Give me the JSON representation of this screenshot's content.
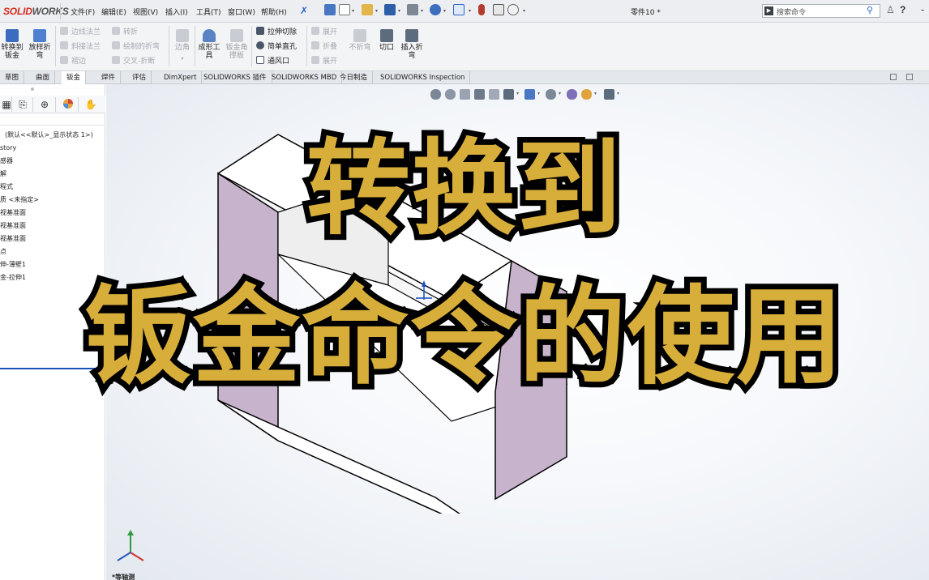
{
  "app": {
    "logo_brand": "SOLID",
    "logo_rest": "WORKS",
    "document_title": "零件10 *"
  },
  "menu": [
    "文件(F)",
    "编辑(E)",
    "视图(V)",
    "插入(I)",
    "工具(T)",
    "窗口(W)",
    "帮助(H)"
  ],
  "search": {
    "placeholder": "搜索命令"
  },
  "help_label": "?",
  "ribbon": {
    "convert_to_sheetmetal": "转换到\n钣金",
    "lofted_bend": "放样折\n弯",
    "edge_flange": "边线法兰",
    "miter_flange": "斜接法兰",
    "hem": "褶边",
    "jog": "转折",
    "sketched_bend": "绘制的折弯",
    "cross_break": "交叉-折断",
    "corners": "边角",
    "forming_tool": "成形工\n具",
    "sheetmetal_gusset": "钣金角\n撑板",
    "extruded_cut": "拉伸切除",
    "simple_hole": "简单直孔",
    "vent": "通风口",
    "unfold": "展开",
    "fold": "折叠",
    "flatten": "展开",
    "no_bends": "不折弯",
    "rip": "切口",
    "insert_bends": "插入折\n弯"
  },
  "tabs": [
    "草图",
    "曲面",
    "钣金",
    "焊件",
    "评估",
    "DimXpert",
    "SOLIDWORKS 插件",
    "SOLIDWORKS MBD",
    "今日制造",
    "SOLIDWORKS Inspection"
  ],
  "active_tab": "钣金",
  "feature_tree": {
    "config_line": "(默认<<默认>_显示状态 1>)",
    "items": [
      "story",
      "感器",
      "解",
      "程式",
      "质 <未指定>",
      "视基准面",
      "视基准面",
      "视基准面",
      "点",
      "伸-薄壁1",
      "金-拉伸1"
    ]
  },
  "view_label": "*等轴测",
  "overlay": {
    "line1": "转换到",
    "line2": "钣金命令的使用"
  },
  "colors": {
    "overlay_text": "#d8ae3a",
    "overlay_outline": "#000000",
    "model_side_face": "#c8b3cc",
    "accent_blue": "#2a66c9",
    "logo_red": "#d52b1e"
  }
}
